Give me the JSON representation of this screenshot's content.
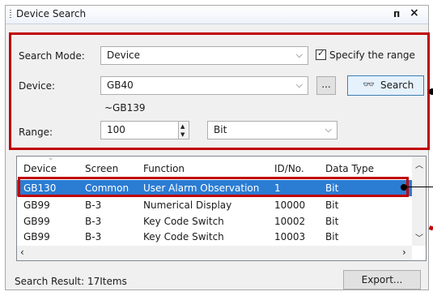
{
  "window": {
    "title": "Device Search",
    "pin_icon": "pin-icon",
    "close_icon": "close-icon"
  },
  "search_mode": {
    "label": "Search Mode:",
    "value": "Device"
  },
  "specify_range": {
    "label": "Specify the range",
    "checked": true
  },
  "device": {
    "label": "Device:",
    "value": "GB40",
    "browse_label": "...",
    "range_end": "~GB139"
  },
  "search_button": {
    "label": "Search",
    "icon": "binoculars-icon"
  },
  "range": {
    "label": "Range:",
    "value": "100",
    "unit": "Bit"
  },
  "table": {
    "columns": [
      "Device",
      "Screen",
      "Function",
      "ID/No.",
      "Data Type"
    ],
    "rows": [
      {
        "device": "GB130",
        "screen": "Common",
        "function": "User Alarm Observation",
        "id": "1",
        "type": "Bit",
        "selected": true
      },
      {
        "device": "GB99",
        "screen": "B-3",
        "function": "Numerical Display",
        "id": "10000",
        "type": "Bit"
      },
      {
        "device": "GB99",
        "screen": "B-3",
        "function": "Key Code Switch",
        "id": "10002",
        "type": "Bit"
      },
      {
        "device": "GB99",
        "screen": "B-3",
        "function": "Key Code Switch",
        "id": "10003",
        "type": "Bit"
      }
    ]
  },
  "footer": {
    "result": "Search Result: 17Items",
    "export_label": "Export..."
  },
  "colors": {
    "highlight": "#c00000",
    "selection": "#2b7cd3"
  }
}
